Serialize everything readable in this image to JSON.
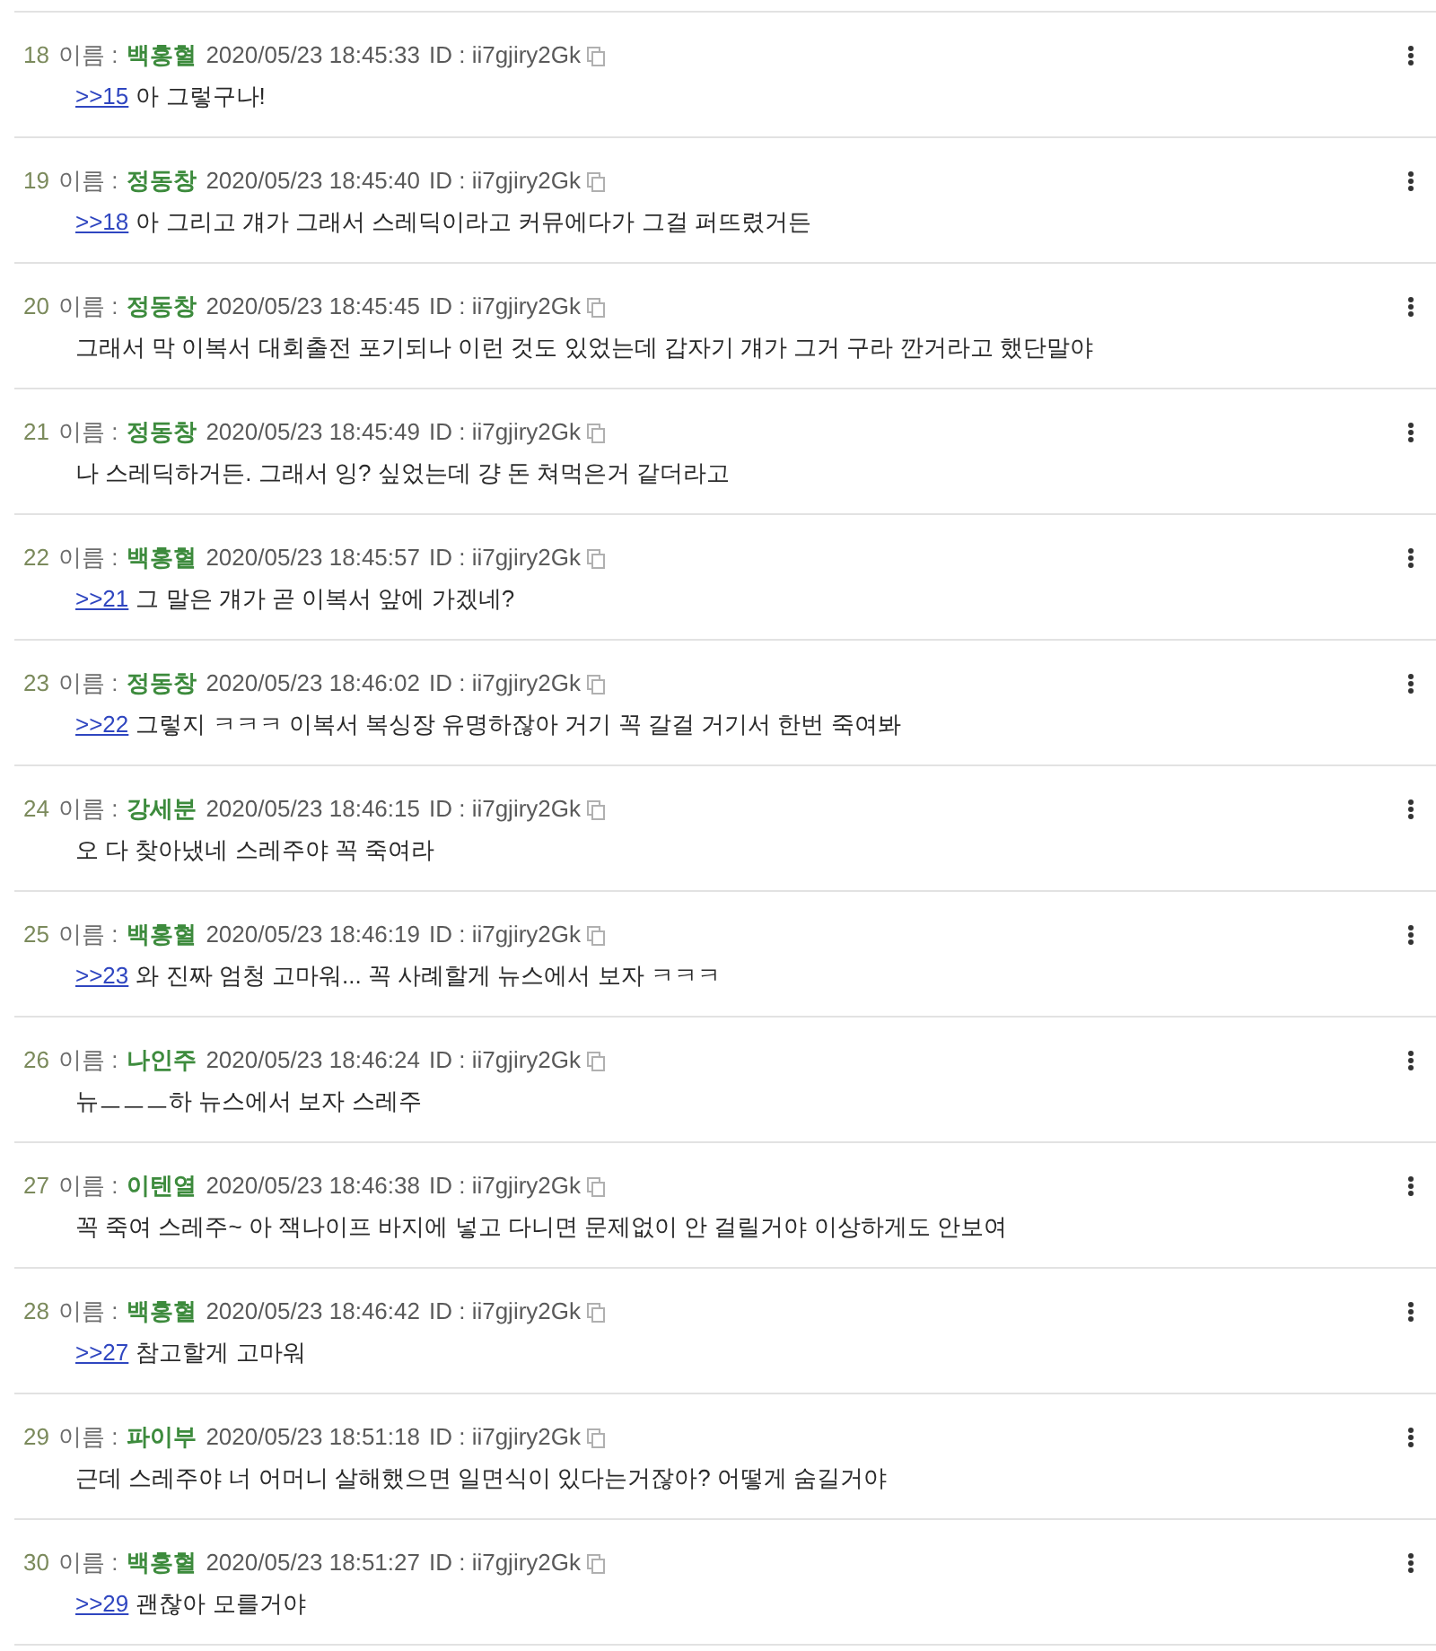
{
  "posts": [
    {
      "number": "18",
      "name_label": "이름 :",
      "name": "백홍혈",
      "datetime": "2020/05/23 18:45:33",
      "id": "ID : ii7gjiry2Gk",
      "reply": ">>15",
      "text": "아 그렇구나!"
    },
    {
      "number": "19",
      "name_label": "이름 :",
      "name": "정동창",
      "datetime": "2020/05/23 18:45:40",
      "id": "ID : ii7gjiry2Gk",
      "reply": ">>18",
      "text": "아 그리고 걔가 그래서 스레딕이라고 커뮤에다가 그걸 퍼뜨렸거든"
    },
    {
      "number": "20",
      "name_label": "이름 :",
      "name": "정동창",
      "datetime": "2020/05/23 18:45:45",
      "id": "ID : ii7gjiry2Gk",
      "text": "그래서 막 이복서 대회출전 포기되나 이런 것도 있었는데 갑자기 걔가 그거 구라 깐거라고 했단말야"
    },
    {
      "number": "21",
      "name_label": "이름 :",
      "name": "정동창",
      "datetime": "2020/05/23 18:45:49",
      "id": "ID : ii7gjiry2Gk",
      "text": "나 스레딕하거든. 그래서 잉? 싶었는데 걍 돈 쳐먹은거 같더라고"
    },
    {
      "number": "22",
      "name_label": "이름 :",
      "name": "백홍혈",
      "datetime": "2020/05/23 18:45:57",
      "id": "ID : ii7gjiry2Gk",
      "reply": ">>21",
      "text": "그 말은 걔가 곧 이복서 앞에 가겠네?"
    },
    {
      "number": "23",
      "name_label": "이름 :",
      "name": "정동창",
      "datetime": "2020/05/23 18:46:02",
      "id": "ID : ii7gjiry2Gk",
      "reply": ">>22",
      "text": "그렇지 ㅋㅋㅋ 이복서 복싱장 유명하잖아 거기 꼭 갈걸 거기서 한번 죽여봐"
    },
    {
      "number": "24",
      "name_label": "이름 :",
      "name": "강세분",
      "datetime": "2020/05/23 18:46:15",
      "id": "ID : ii7gjiry2Gk",
      "text": "오 다 찾아냈네 스레주야 꼭 죽여라"
    },
    {
      "number": "25",
      "name_label": "이름 :",
      "name": "백홍혈",
      "datetime": "2020/05/23 18:46:19",
      "id": "ID : ii7gjiry2Gk",
      "reply": ">>23",
      "text": "와 진짜 엄청 고마워... 꼭 사례할게 뉴스에서 보자 ㅋㅋㅋ"
    },
    {
      "number": "26",
      "name_label": "이름 :",
      "name": "나인주",
      "datetime": "2020/05/23 18:46:24",
      "id": "ID : ii7gjiry2Gk",
      "text": "뉴ㅡㅡㅡ하 뉴스에서 보자 스레주"
    },
    {
      "number": "27",
      "name_label": "이름 :",
      "name": "이텐열",
      "datetime": "2020/05/23 18:46:38",
      "id": "ID : ii7gjiry2Gk",
      "text": "꼭 죽여 스레주~ 아 잭나이프 바지에 넣고 다니면 문제없이 안 걸릴거야 이상하게도 안보여"
    },
    {
      "number": "28",
      "name_label": "이름 :",
      "name": "백홍혈",
      "datetime": "2020/05/23 18:46:42",
      "id": "ID : ii7gjiry2Gk",
      "reply": ">>27",
      "text": "참고할게 고마워"
    },
    {
      "number": "29",
      "name_label": "이름 :",
      "name": "파이부",
      "datetime": "2020/05/23 18:51:18",
      "id": "ID : ii7gjiry2Gk",
      "text": "근데 스레주야 너 어머니 살해했으면 일면식이 있다는거잖아? 어떻게 숨길거야"
    },
    {
      "number": "30",
      "name_label": "이름 :",
      "name": "백홍혈",
      "datetime": "2020/05/23 18:51:27",
      "id": "ID : ii7gjiry2Gk",
      "reply": ">>29",
      "text": "괜찮아 모를거야"
    }
  ]
}
